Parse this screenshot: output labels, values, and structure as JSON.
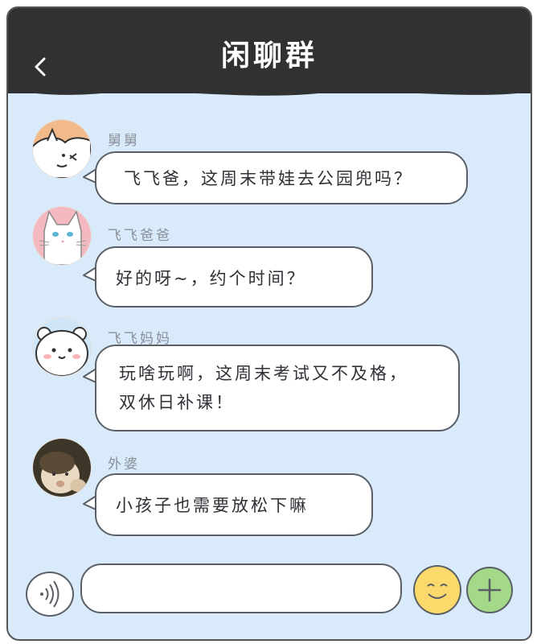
{
  "header": {
    "title": "闲聊群",
    "back_icon": "chevron-left-icon"
  },
  "messages": [
    {
      "sender": "舅舅",
      "text": "飞飞爸，这周末带娃去公园兜吗？",
      "avatar": "cat-peeking-avatar"
    },
    {
      "sender": "飞飞爸爸",
      "text": "好的呀~，约个时间？",
      "avatar": "white-cat-avatar"
    },
    {
      "sender": "飞飞妈妈",
      "text_line1": "玩啥玩啊，这周末考试又不及格，",
      "text_line2": "双休日补课！",
      "avatar": "white-bear-avatar"
    },
    {
      "sender": "外婆",
      "text": "小孩子也需要放松下嘛",
      "avatar": "baby-photo-avatar"
    }
  ],
  "input_bar": {
    "message_value": "",
    "voice_icon": "voice-wave-icon",
    "emoji_icon": "smile-icon",
    "plus_icon": "plus-icon"
  },
  "colors": {
    "header_bg": "#2f3133",
    "chat_bg": "#d9ebfb",
    "emoji_btn": "#fbd96a",
    "plus_btn": "#a4d98a"
  }
}
